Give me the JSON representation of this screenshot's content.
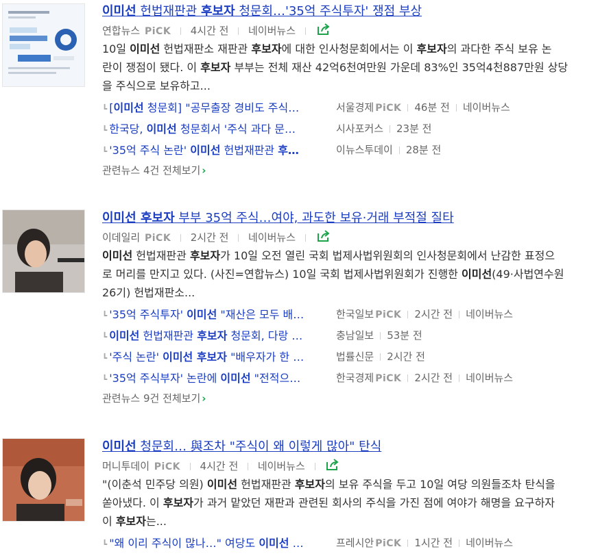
{
  "articles": [
    {
      "title_parts": [
        {
          "t": "이미선",
          "b": true
        },
        {
          "t": " 헌법재판관 ",
          "b": false
        },
        {
          "t": "후보자",
          "b": true
        },
        {
          "t": " 청문회…'35억 주식투자' 쟁점 부상",
          "b": false
        }
      ],
      "source": "연합뉴스",
      "pick": "PiCK",
      "time": "4시간 전",
      "portal": "네이버뉴스",
      "desc_lines": [
        [
          {
            "t": "10일 ",
            "b": false
          },
          {
            "t": "이미선",
            "b": true
          },
          {
            "t": " 헌법재판소 재판관 ",
            "b": false
          },
          {
            "t": "후보자",
            "b": true
          },
          {
            "t": "에 대한 인사청문회에서는 이 ",
            "b": false
          },
          {
            "t": "후보자",
            "b": true
          },
          {
            "t": "의 과다한 주식 보유 논",
            "b": false
          }
        ],
        [
          {
            "t": "란이 쟁점이 됐다. 이 ",
            "b": false
          },
          {
            "t": "후보자",
            "b": true
          },
          {
            "t": " 부부는 전체 재산 42억6천여만원 가운데 83%인 35억4천887만원 상당",
            "b": false
          }
        ],
        [
          {
            "t": "을 주식으로 보유하고...",
            "b": false
          }
        ]
      ],
      "related": [
        {
          "parts": [
            {
              "t": "[",
              "b": false
            },
            {
              "t": "이미선",
              "b": true
            },
            {
              "t": " 청문회] \"공무출장 경비도 주식…",
              "b": false
            }
          ],
          "source": "서울경제",
          "pick": "PiCK",
          "time": "46분 전",
          "portal": "네이버뉴스"
        },
        {
          "parts": [
            {
              "t": "한국당, ",
              "b": false
            },
            {
              "t": "이미선",
              "b": true
            },
            {
              "t": " 청문회서 '주식 과다 문…",
              "b": false
            }
          ],
          "source": "시사포커스",
          "pick": "",
          "time": "23분 전",
          "portal": ""
        },
        {
          "parts": [
            {
              "t": "'35억 주식 논란' ",
              "b": false
            },
            {
              "t": "이미선",
              "b": true
            },
            {
              "t": " 헌법재판관 ",
              "b": false
            },
            {
              "t": "후…",
              "b": true
            }
          ],
          "source": "이뉴스투데이",
          "pick": "",
          "time": "28분 전",
          "portal": ""
        }
      ],
      "more": "관련뉴스 4건 전체보기"
    },
    {
      "title_parts": [
        {
          "t": "이미선 후보자",
          "b": true
        },
        {
          "t": " 부부 35억 주식…여야, 과도한 보유·거래 부적절 질타",
          "b": false
        }
      ],
      "source": "이데일리",
      "pick": "PiCK",
      "time": "2시간 전",
      "portal": "네이버뉴스",
      "desc_lines": [
        [
          {
            "t": "이미선",
            "b": true
          },
          {
            "t": " 헌법재판관 ",
            "b": false
          },
          {
            "t": "후보자",
            "b": true
          },
          {
            "t": "가 10일 오전 열린 국회 법제사법위원회의 인사청문회에서 난감한 표정으",
            "b": false
          }
        ],
        [
          {
            "t": "로 머리를 만지고 있다. (사진=연합뉴스) 10일 국회 법제사법위원회가 진행한 ",
            "b": false
          },
          {
            "t": "이미선",
            "b": true
          },
          {
            "t": "(49·사법연수원",
            "b": false
          }
        ],
        [
          {
            "t": "26기) 헌법재판소...",
            "b": false
          }
        ]
      ],
      "related": [
        {
          "parts": [
            {
              "t": "'35억 주식투자' ",
              "b": false
            },
            {
              "t": "이미선",
              "b": true
            },
            {
              "t": " \"재산은 모두 배…",
              "b": false
            }
          ],
          "source": "한국일보",
          "pick": "PiCK",
          "time": "2시간 전",
          "portal": "네이버뉴스"
        },
        {
          "parts": [
            {
              "t": "이미선",
              "b": true
            },
            {
              "t": " 헌법재판관 ",
              "b": false
            },
            {
              "t": "후보자",
              "b": true
            },
            {
              "t": " 청문회, 다랑 …",
              "b": false
            }
          ],
          "source": "충남일보",
          "pick": "",
          "time": "53분 전",
          "portal": ""
        },
        {
          "parts": [
            {
              "t": "'주식 논란' ",
              "b": false
            },
            {
              "t": "이미선 후보자",
              "b": true
            },
            {
              "t": " \"배우자가 한 …",
              "b": false
            }
          ],
          "source": "법률신문",
          "pick": "",
          "time": "2시간 전",
          "portal": ""
        },
        {
          "parts": [
            {
              "t": "'35억 주식부자' 논란에 ",
              "b": false
            },
            {
              "t": "이미선",
              "b": true
            },
            {
              "t": " \"전적으…",
              "b": false
            }
          ],
          "source": "한국경제",
          "pick": "PiCK",
          "time": "2시간 전",
          "portal": "네이버뉴스"
        }
      ],
      "more": "관련뉴스 9건 전체보기"
    },
    {
      "title_parts": [
        {
          "t": "이미선",
          "b": true
        },
        {
          "t": " 청문회… 與조차 \"주식이 왜 이렇게 많아\" 탄식",
          "b": false
        }
      ],
      "source": "머니투데이",
      "pick": "PiCK",
      "time": "4시간 전",
      "portal": "네이버뉴스",
      "desc_lines": [
        [
          {
            "t": "\"(이춘석 민주당 의원) ",
            "b": false
          },
          {
            "t": "이미선",
            "b": true
          },
          {
            "t": " 헌법재판관 ",
            "b": false
          },
          {
            "t": "후보자",
            "b": true
          },
          {
            "t": "의 보유 주식을 두고 10일 여당 의원들조차 탄식을",
            "b": false
          }
        ],
        [
          {
            "t": "쏟아냈다. 이 ",
            "b": false
          },
          {
            "t": "후보자",
            "b": true
          },
          {
            "t": "가 과거 맡았던 재판과 관련된 회사의 주식을 가진 점에 여야가 해명을 요구하자",
            "b": false
          }
        ],
        [
          {
            "t": "이 ",
            "b": false
          },
          {
            "t": "후보자",
            "b": true
          },
          {
            "t": "는...",
            "b": false
          }
        ]
      ],
      "related": [
        {
          "parts": [
            {
              "t": "\"왜 이리 주식이 많나…\" 여당도 ",
              "b": false
            },
            {
              "t": "이미선",
              "b": true
            },
            {
              "t": " …",
              "b": false
            }
          ],
          "source": "프레시안",
          "pick": "PiCK",
          "time": "1시간 전",
          "portal": "네이버뉴스"
        }
      ],
      "more": ""
    }
  ],
  "colors": {
    "link": "#1a3dc1",
    "meta": "#666666",
    "share_icon": "#1ca34a",
    "more_chevron": "#1ca34a"
  }
}
